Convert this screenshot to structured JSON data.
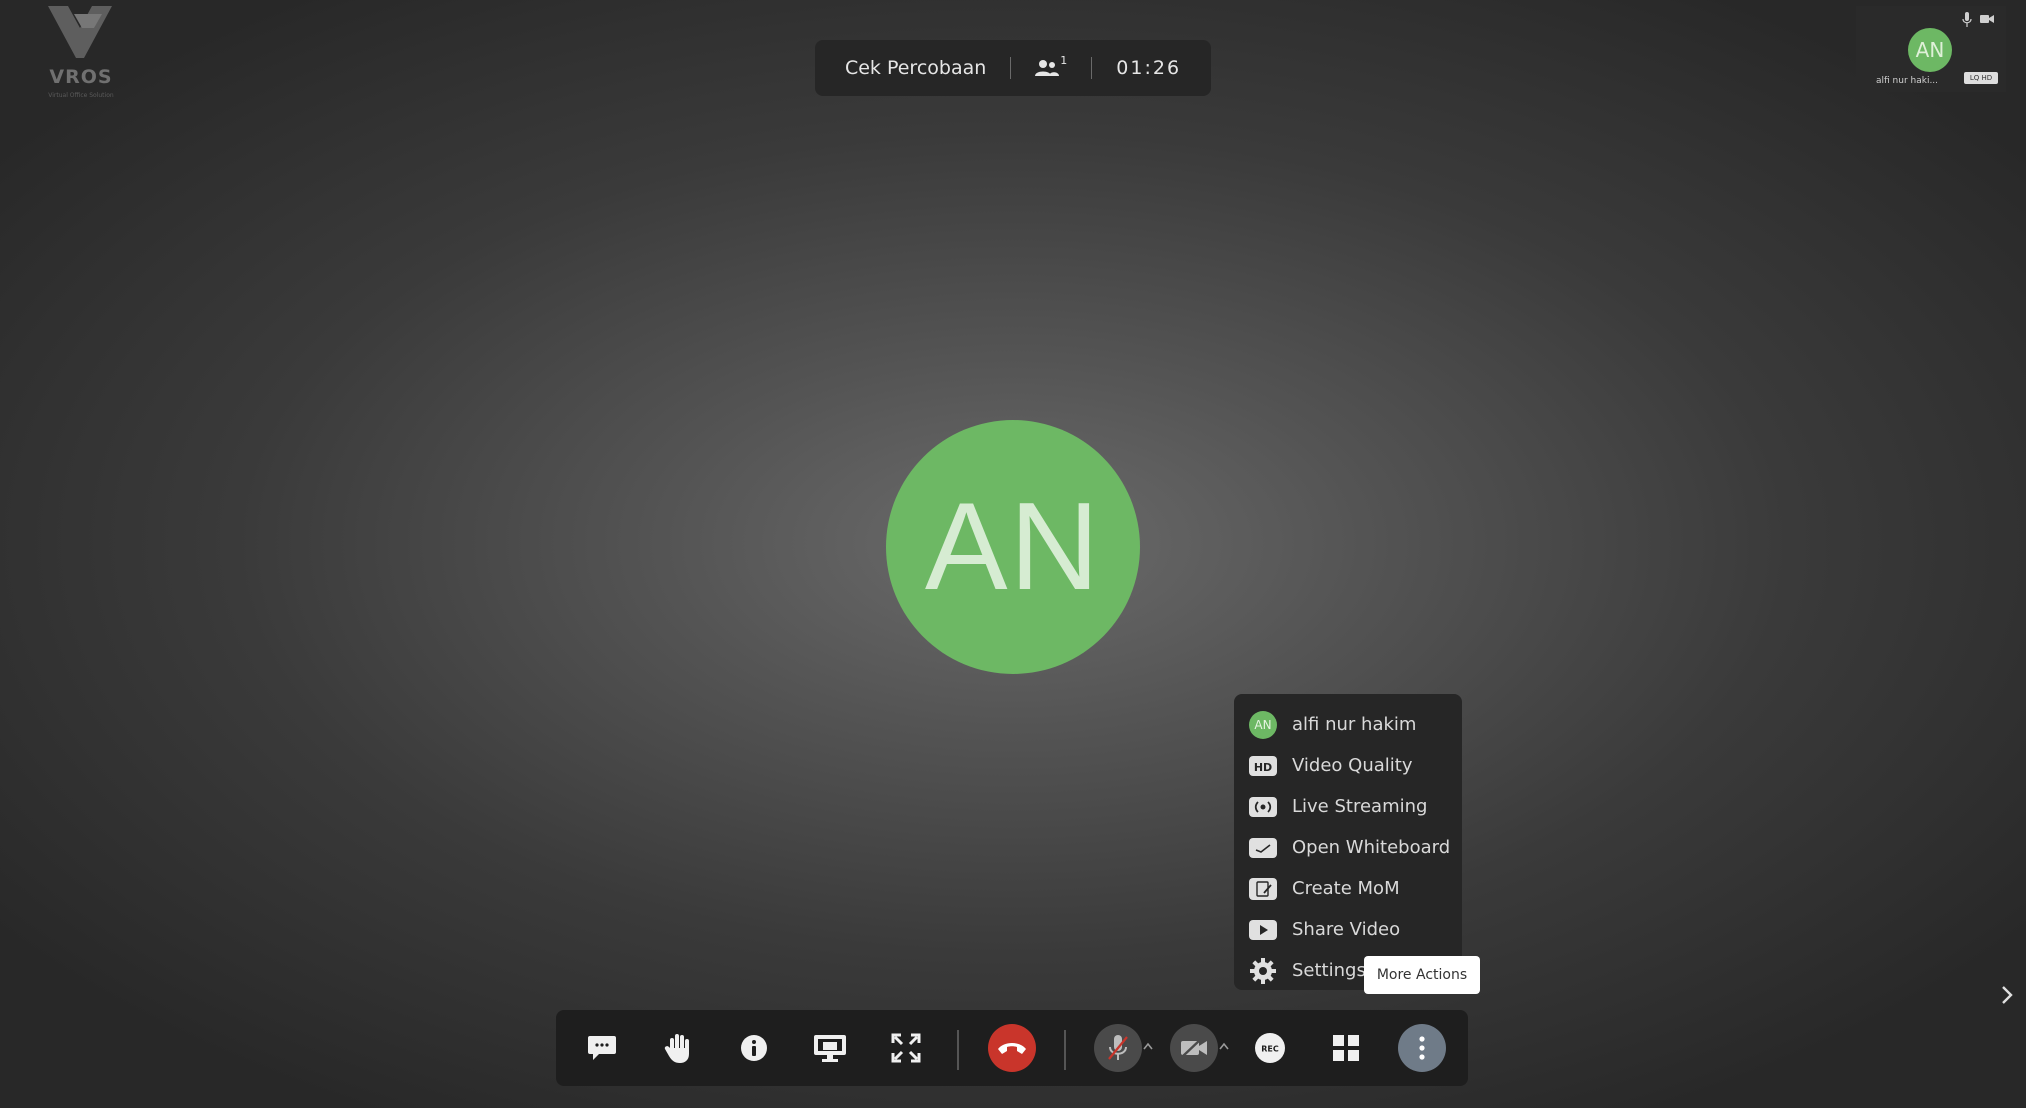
{
  "app": {
    "logo_text": "VROS",
    "logo_tagline": "Virtual Office Solution"
  },
  "meeting": {
    "title": "Cek Percobaan",
    "participant_count": "1",
    "timer": "01:26"
  },
  "self_view": {
    "initials": "AN",
    "name": "alfi nur haki...",
    "quality_badge": "LQ HD"
  },
  "main_participant": {
    "initials": "AN"
  },
  "more_actions_menu": {
    "items": [
      {
        "icon": "user-avatar",
        "label": "alfi nur hakim",
        "avatar_initials": "AN"
      },
      {
        "icon": "hd-icon",
        "label": "Video Quality"
      },
      {
        "icon": "live-streaming-icon",
        "label": "Live Streaming"
      },
      {
        "icon": "whiteboard-icon",
        "label": "Open Whiteboard"
      },
      {
        "icon": "create-mom-icon",
        "label": "Create MoM"
      },
      {
        "icon": "share-video-icon",
        "label": "Share Video"
      },
      {
        "icon": "gear-icon",
        "label": "Settings"
      }
    ]
  },
  "tooltip": {
    "text": "More Actions"
  },
  "toolbar": {
    "buttons": [
      {
        "name": "chat",
        "icon": "chat-icon"
      },
      {
        "name": "raise-hand",
        "icon": "hand-icon"
      },
      {
        "name": "info",
        "icon": "info-icon"
      },
      {
        "name": "share-screen",
        "icon": "screen-share-icon"
      },
      {
        "name": "fullscreen",
        "icon": "fullscreen-icon"
      },
      {
        "name": "hangup",
        "icon": "phone-hangup-icon"
      },
      {
        "name": "microphone",
        "icon": "mic-muted-icon"
      },
      {
        "name": "camera",
        "icon": "camera-off-icon"
      },
      {
        "name": "record",
        "icon": "rec-icon",
        "label": "REC"
      },
      {
        "name": "tile-view",
        "icon": "grid-icon"
      },
      {
        "name": "more-actions",
        "icon": "more-vertical-icon"
      }
    ]
  },
  "colors": {
    "avatar_green": "#6db864",
    "hangup_red": "#c9352b",
    "more_button": "#6f7b88",
    "panel_bg": "#262626"
  }
}
